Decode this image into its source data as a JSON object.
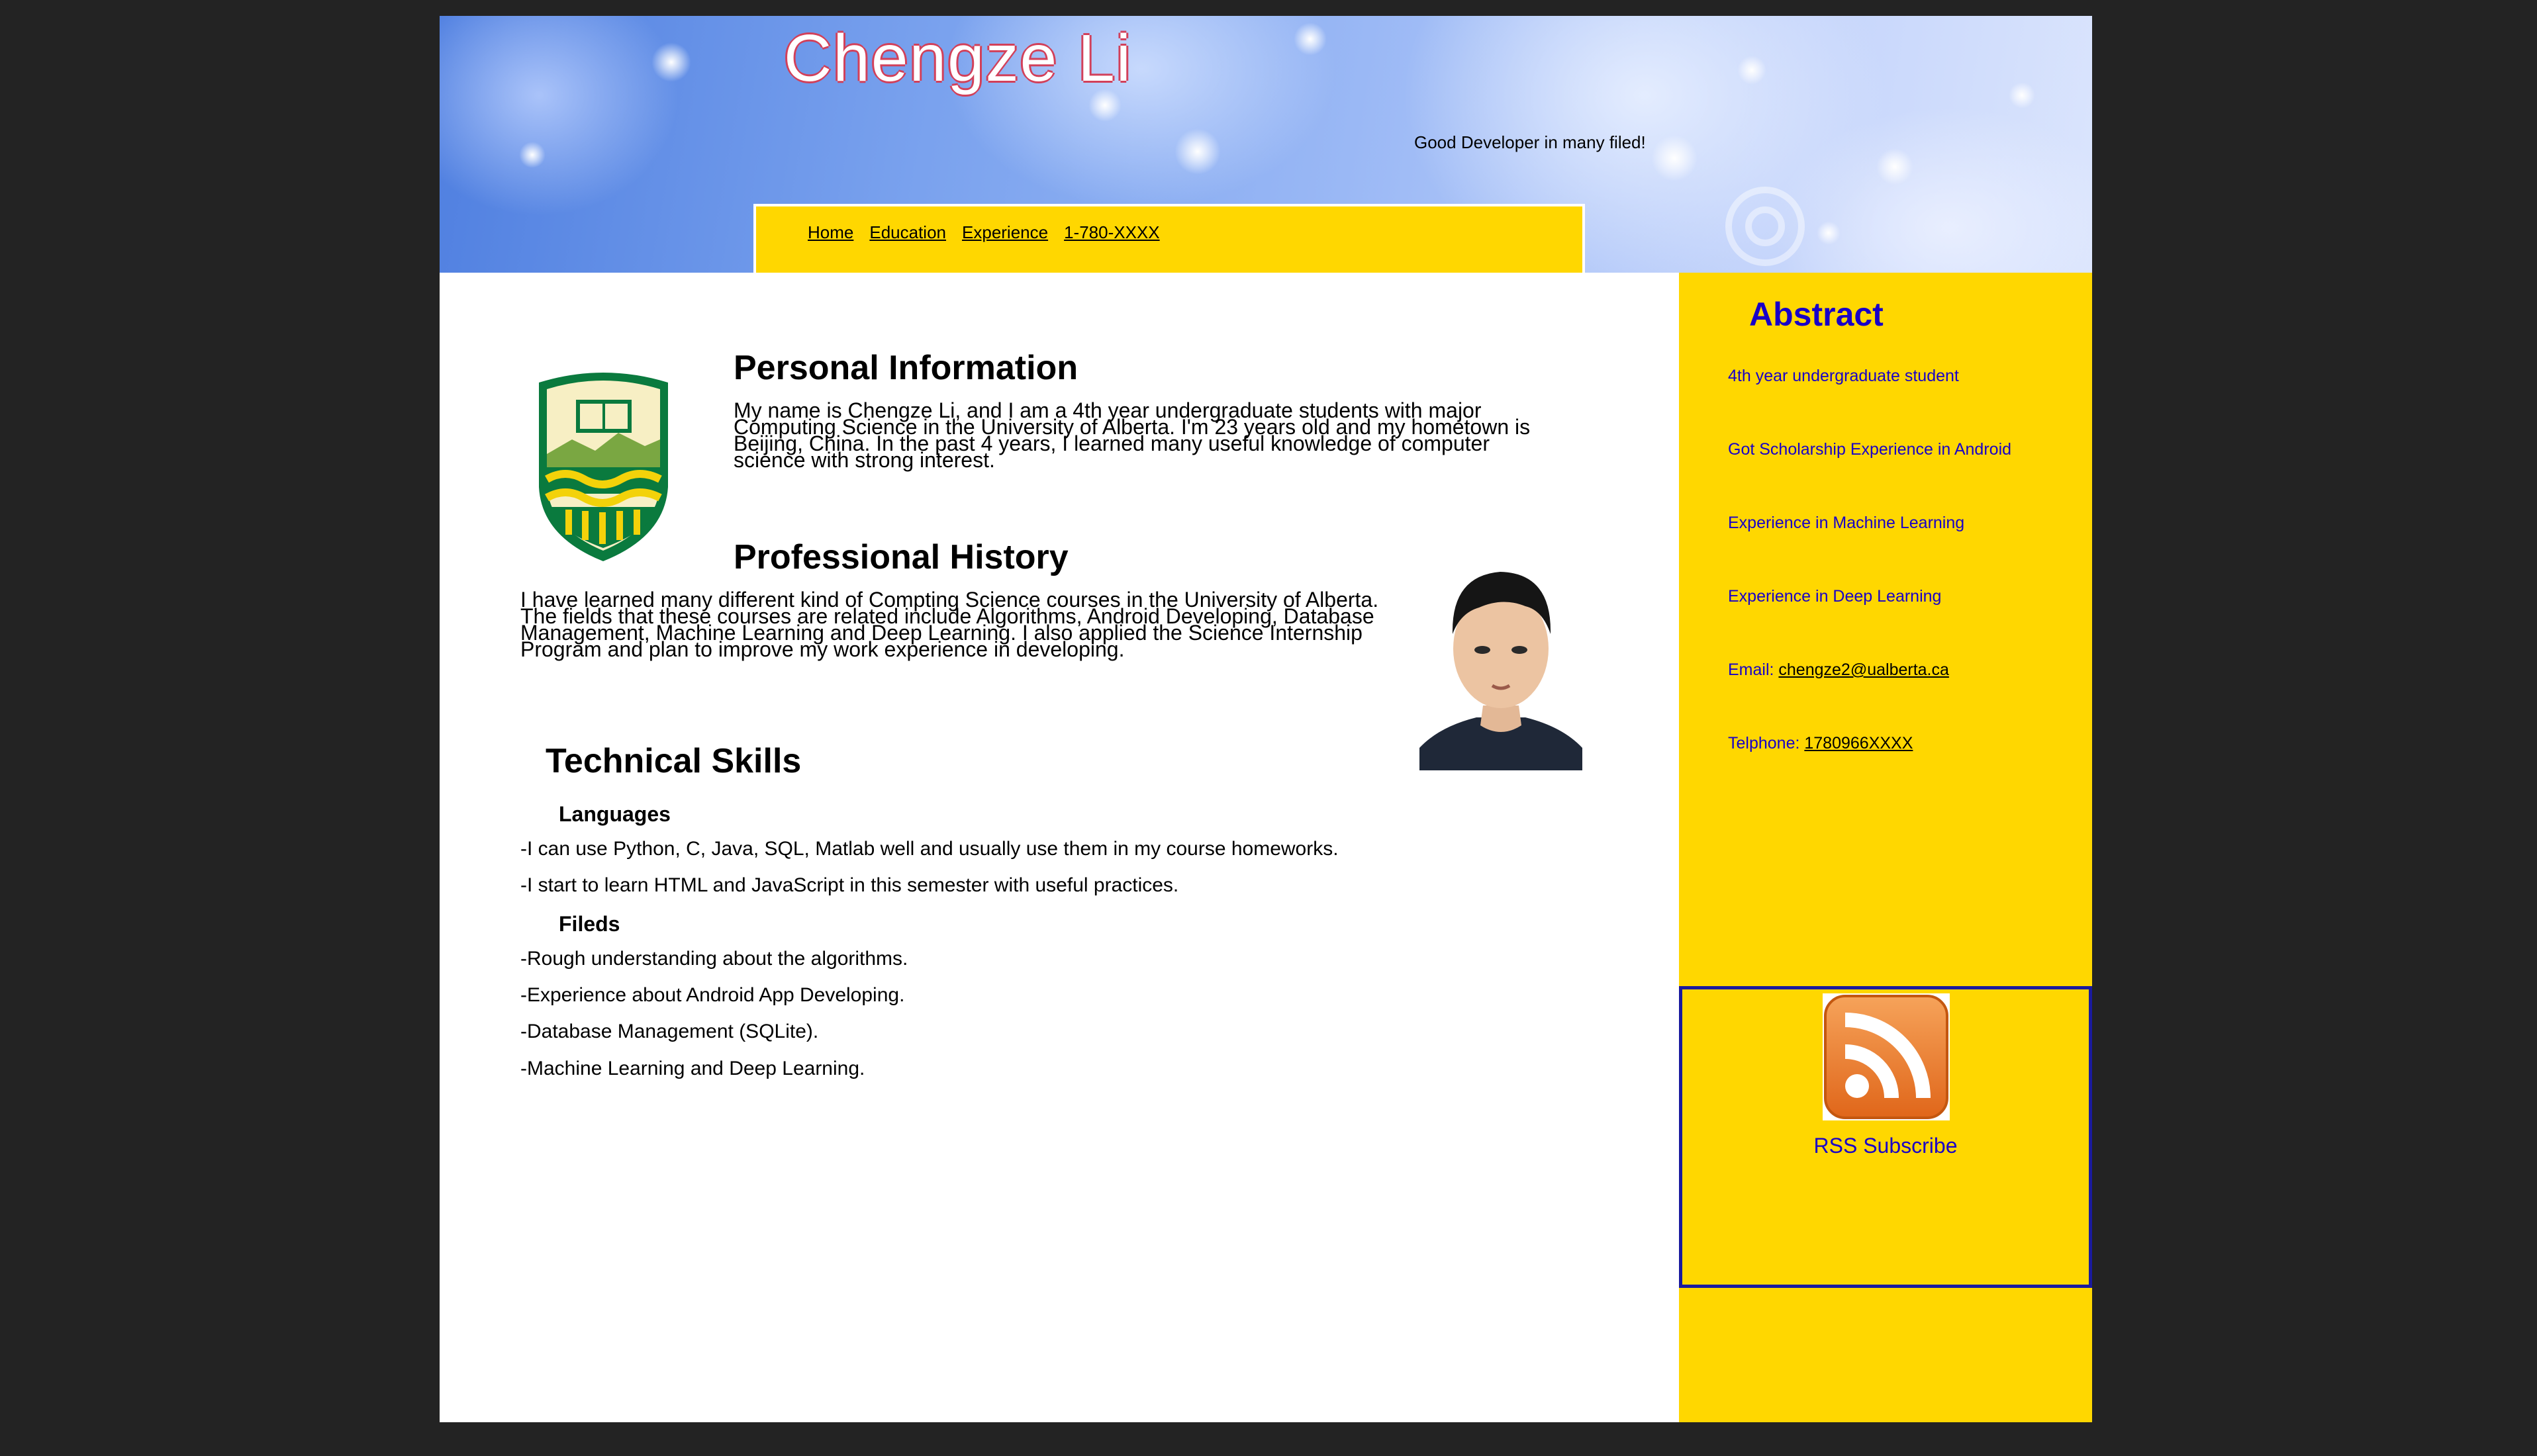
{
  "header": {
    "title": "Chengze Li",
    "tagline": "Good Developer in many filed!",
    "nav": [
      "Home",
      "Education",
      "Experience",
      "1-780-XXXX"
    ]
  },
  "main": {
    "personal": {
      "heading": "Personal Information",
      "text": "My name is Chengze Li, and I am a 4th year undergraduate students with major Computing Science in the University of Alberta. I'm 23 years old and my hometown is Beijing, China. In the past 4 years, I learned many useful knowledge of computer science with strong interest."
    },
    "professional": {
      "heading": "Professional History",
      "text": "I have learned many different kind of Compting Science courses in the University of Alberta. The fields that these courses are related include Algorithms, Android Developing, Database Management, Machine Learning and Deep Learning. I also applied the Science Internship Program and plan to improve my work experience in developing."
    },
    "skills": {
      "heading": "Technical Skills",
      "languages_label": "Languages",
      "languages": [
        "-I can use Python, C, Java, SQL, Matlab well and usually use them in my course homeworks.",
        "-I start to learn HTML and JavaScript in this semester with useful practices."
      ],
      "fields_label": "Fileds",
      "fields": [
        "-Rough understanding about the algorithms.",
        "-Experience about Android App Developing.",
        "-Database Management (SQLite).",
        "-Machine Learning and Deep Learning."
      ]
    }
  },
  "sidebar": {
    "title": "Abstract",
    "items": [
      "4th year undergraduate student",
      "Got Scholarship  Experience in Android",
      "Experience in Machine Learning",
      "Experience in Deep Learning"
    ],
    "email_label": "Email: ",
    "email": "chengze2@ualberta.ca",
    "phone_label": "Telphone: ",
    "phone": "1780966XXXX",
    "rss_label": "RSS Subscribe"
  },
  "colors": {
    "accent_yellow": "#ffd700",
    "link_blue": "#1800c8",
    "background": "#232323"
  },
  "icons": {
    "crest": "university-crest-icon",
    "rss": "rss-icon",
    "photo": "profile-photo"
  }
}
